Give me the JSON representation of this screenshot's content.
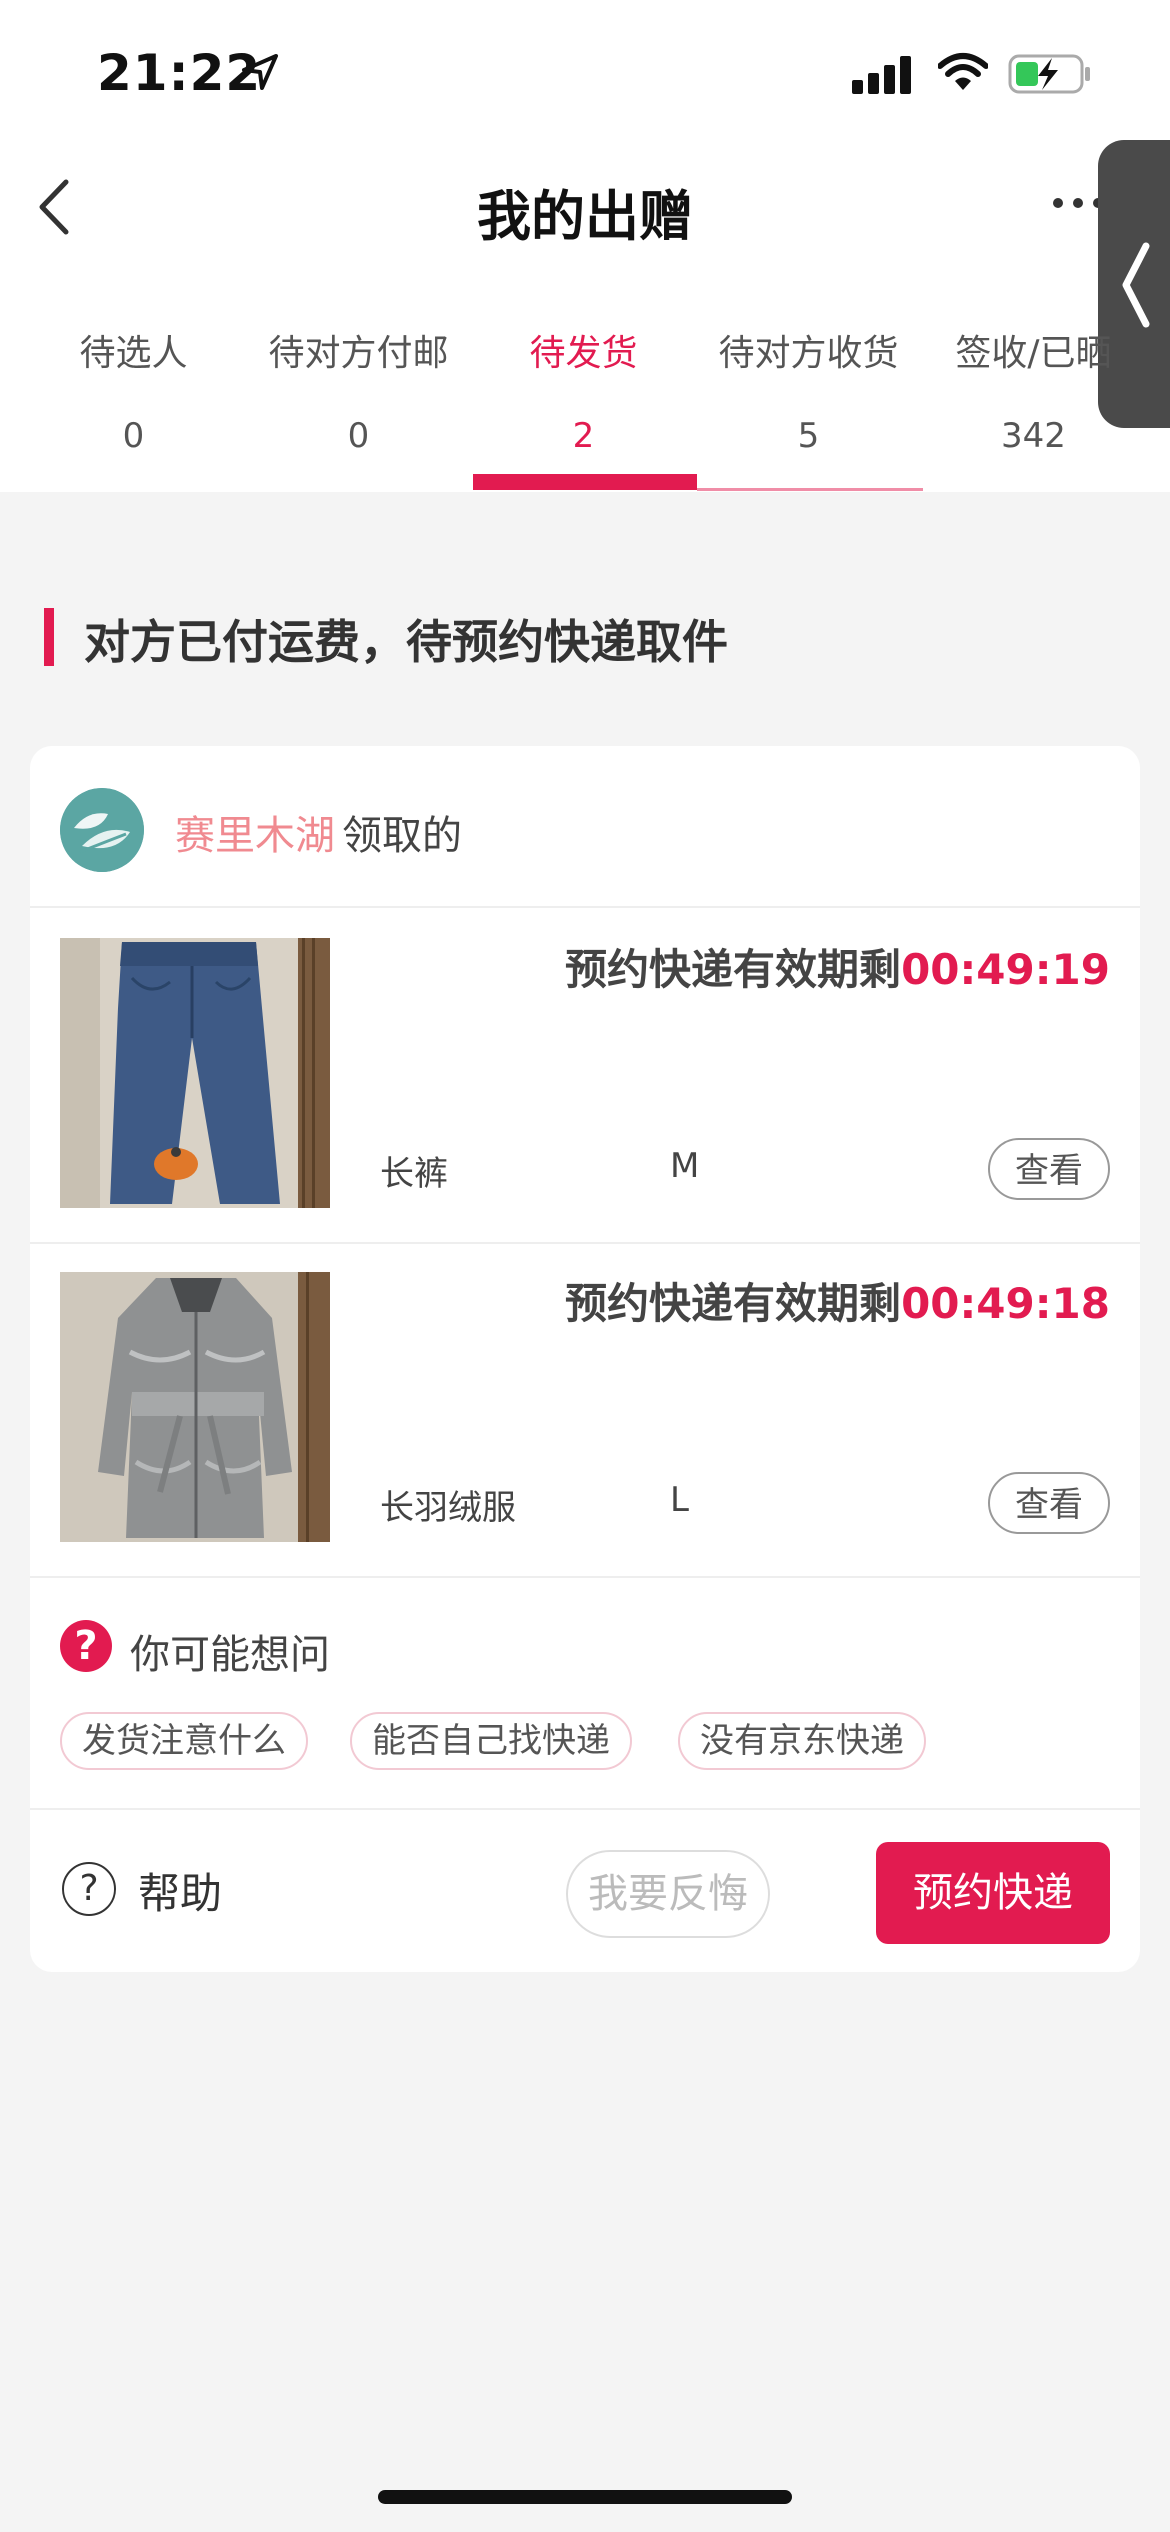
{
  "status_bar": {
    "time": "21:22"
  },
  "header": {
    "title": "我的出赠",
    "back_icon": "chevron-left-icon",
    "more_icon": "ellipsis-icon"
  },
  "tabs": [
    {
      "label": "待选人",
      "count": "0",
      "active": false
    },
    {
      "label": "待对方付邮",
      "count": "0",
      "active": false
    },
    {
      "label": "待发货",
      "count": "2",
      "active": true
    },
    {
      "label": "待对方收货",
      "count": "5",
      "active": false
    },
    {
      "label": "签收/已晒",
      "count": "342",
      "active": false
    }
  ],
  "section": {
    "title": "对方已付运费，待预约快递取件"
  },
  "order": {
    "recipient_name": "赛里木湖",
    "recipient_suffix": "领取的",
    "items": [
      {
        "deadline_label": "预约快递有效期剩",
        "timer": "00:49:19",
        "name": "长裤",
        "size": "M",
        "view_label": "查看"
      },
      {
        "deadline_label": "预约快递有效期剩",
        "timer": "00:49:18",
        "name": "长羽绒服",
        "size": "L",
        "view_label": "查看"
      }
    ],
    "faq": {
      "title": "你可能想问",
      "icon_text": "?",
      "chips": [
        "发货注意什么",
        "能否自己找快递",
        "没有京东快递"
      ]
    },
    "footer": {
      "help_icon_text": "?",
      "help_label": "帮助",
      "regret_label": "我要反悔",
      "book_label": "预约快递"
    }
  },
  "colors": {
    "accent": "#e21b50",
    "recipient_name": "#f08a90",
    "avatar": "#5ba6a3"
  }
}
